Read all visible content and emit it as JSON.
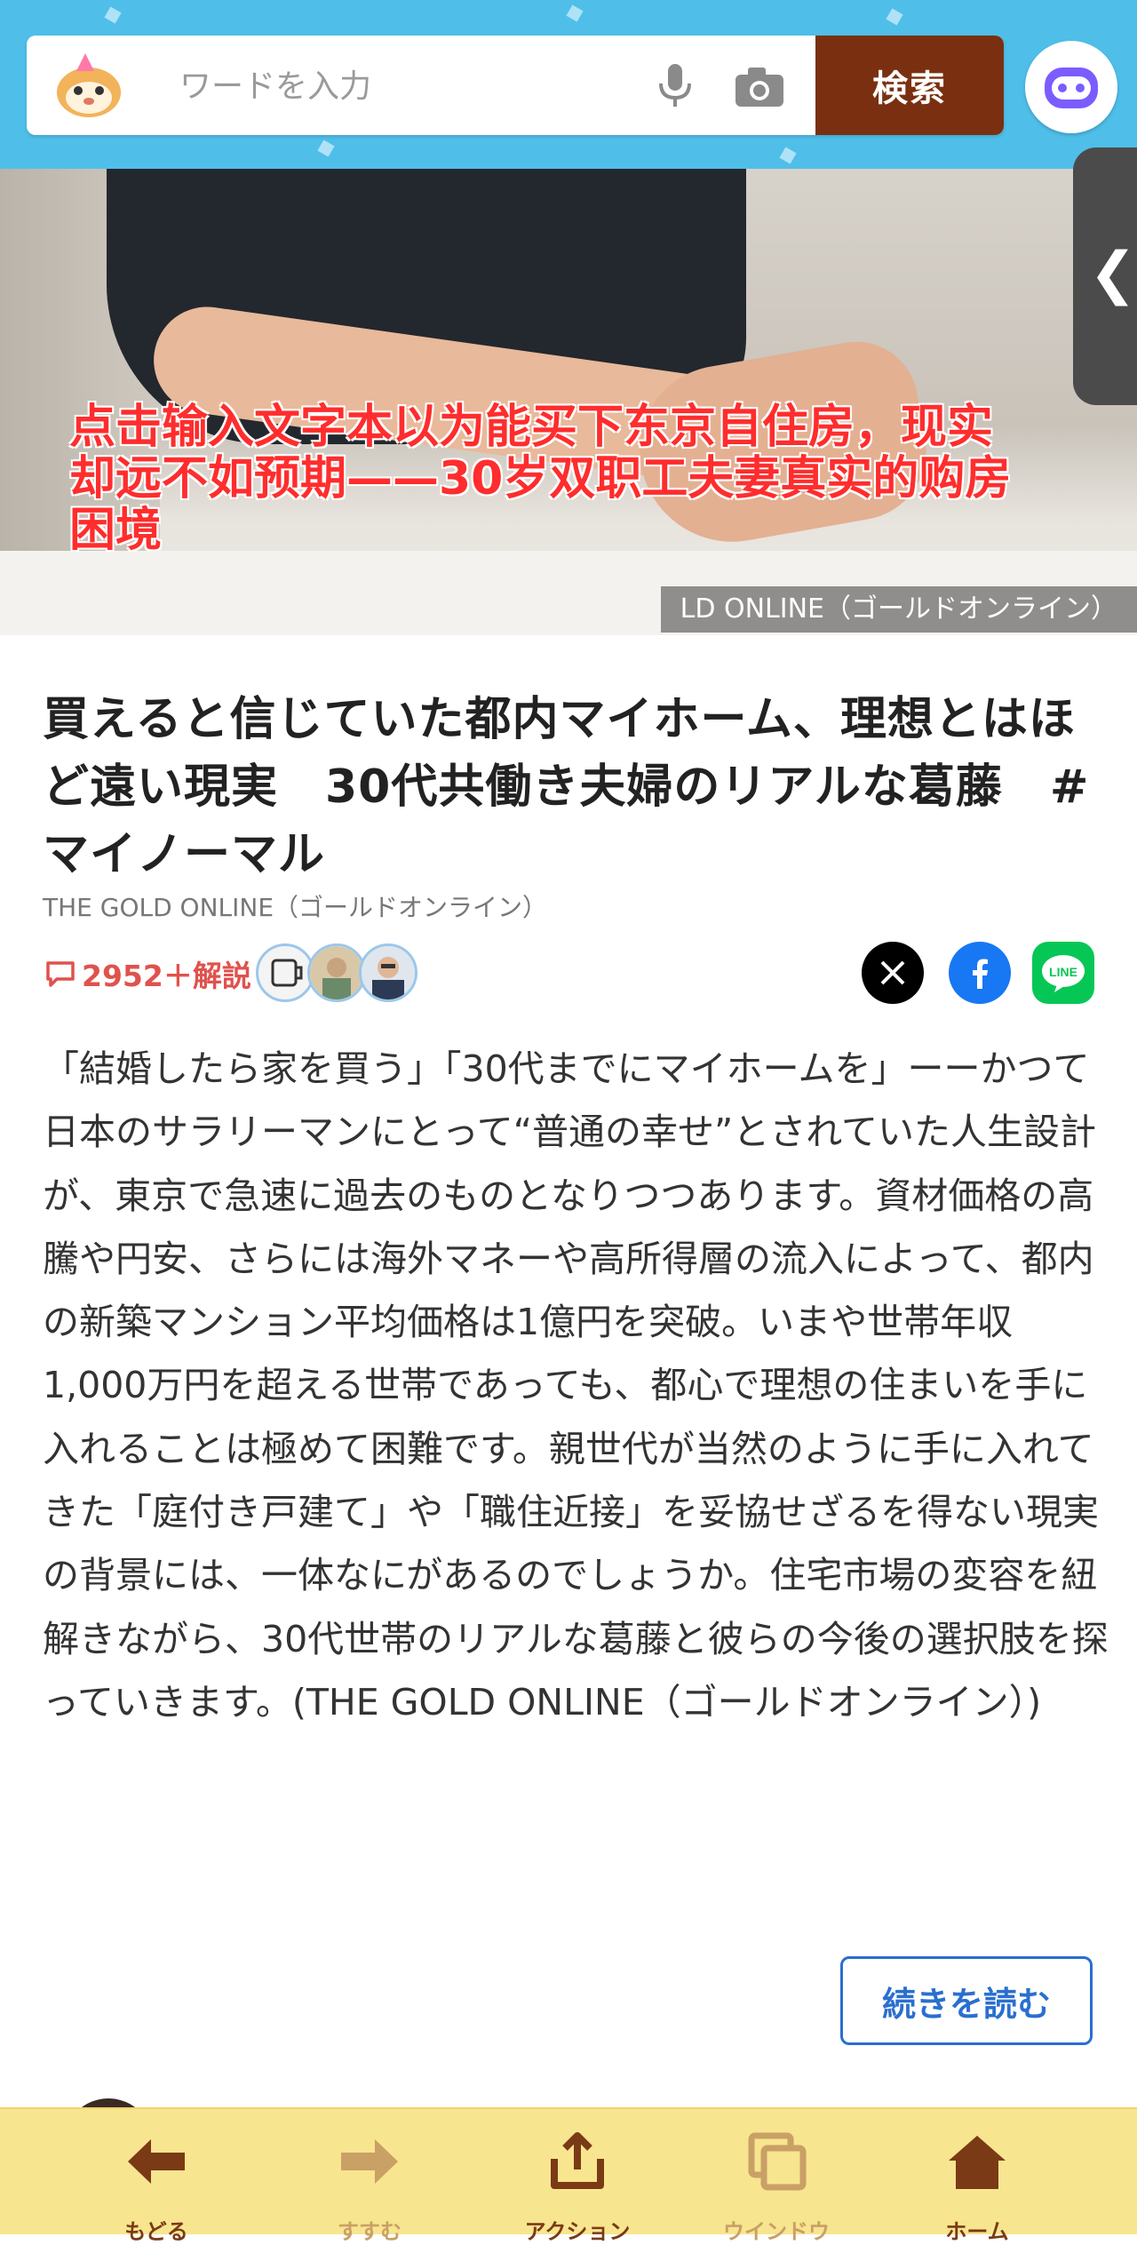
{
  "header": {
    "search_placeholder": "ワードを入力",
    "search_button": "検索"
  },
  "hero": {
    "overlay_caption": "点击输入文字本以为能买下东京自住房，现实却远不如预期——30岁双职工夫妻真实的购房困境",
    "photo_credit": "LD ONLINE（ゴールドオンライン）"
  },
  "article": {
    "title": "買えると信じていた都内マイホーム、理想とはほど遠い現実　30代共働き夫婦のリアルな葛藤　#マイノーマル",
    "source": "THE GOLD ONLINE（ゴールドオンライン）",
    "comments_label": "2952＋解説",
    "body": "「結婚したら家を買う」「30代までにマイホームを」ーーかつて日本のサラリーマンにとって“普通の幸せ”とされていた人生設計が、東京で急速に過去のものとなりつつあります。資材価格の高騰や円安、さらには海外マネーや高所得層の流入によって、都内の新築マンション平均価格は1億円を突破。いまや世帯年収1,000万円を超える世帯であっても、都心で理想の住まいを手に入れることは極めて困難です。親世代が当然のように手に入れてきた「庭付き戸建て」や「職住近接」を妥協せざるを得ない現実の背景には、一体なにがあるのでしょうか。住宅市場の変容を紐解きながら、30代世帯のリアルな葛藤と彼らの今後の選択肢を探っていきます。(THE GOLD ONLINE（ゴールドオンライン）)",
    "read_more": "続きを読む"
  },
  "bottom_nav": {
    "back": "もどる",
    "forward": "すすむ",
    "action": "アクション",
    "window": "ウインドウ",
    "home": "ホーム"
  },
  "colors": {
    "header_bg": "#4fbfea",
    "search_button_bg": "#7a3010",
    "comment_red": "#e0524d",
    "link_blue": "#2a6fcf",
    "nav_bg": "#f8e58f",
    "nav_brown": "#7a3a16"
  },
  "icons": [
    "mascot-icon",
    "mic-icon",
    "camera-icon",
    "assistant-bot-icon",
    "chevron-left-icon",
    "comment-icon",
    "x-icon",
    "facebook-icon",
    "line-icon",
    "back-arrow-icon",
    "forward-arrow-icon",
    "share-action-icon",
    "window-icon",
    "home-icon"
  ]
}
